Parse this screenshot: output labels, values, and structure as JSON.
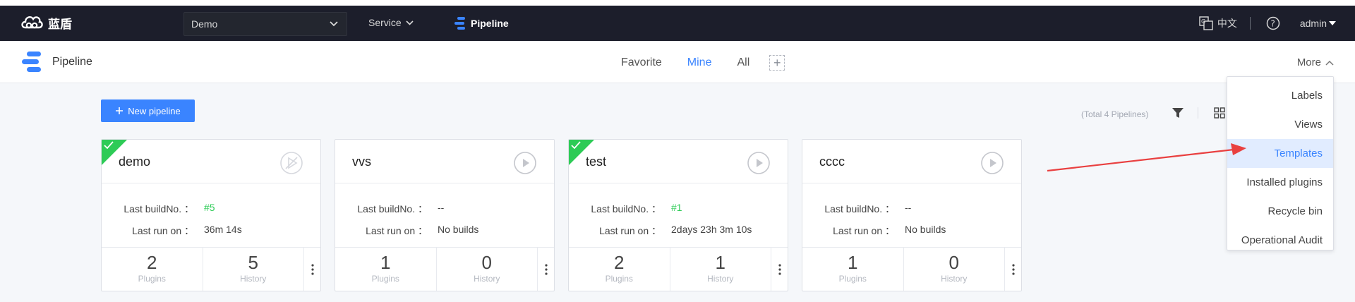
{
  "topnav": {
    "brand": "蓝盾",
    "project_select": "Demo",
    "service_label": "Service",
    "pipeline_label": "Pipeline",
    "language": "中文",
    "user": "admin"
  },
  "subheader": {
    "title": "Pipeline",
    "tabs": [
      {
        "label": "Favorite",
        "active": false
      },
      {
        "label": "Mine",
        "active": true
      },
      {
        "label": "All",
        "active": false
      }
    ],
    "more_label": "More"
  },
  "toolbar": {
    "new_pipeline": "New pipeline",
    "total": "(Total 4 Pipelines)"
  },
  "labels": {
    "last_build": "Last buildNo. ：",
    "last_run": "Last run on ：",
    "plugins": "Plugins",
    "history": "History"
  },
  "cards": [
    {
      "name": "demo",
      "success": true,
      "build_no": "#5",
      "last_run": "36m 14s",
      "plugins": "2",
      "history": "5"
    },
    {
      "name": "vvs",
      "success": false,
      "build_no": "--",
      "last_run": "No builds",
      "plugins": "1",
      "history": "0"
    },
    {
      "name": "test",
      "success": true,
      "build_no": "#1",
      "last_run": "2days 23h 3m 10s",
      "plugins": "2",
      "history": "1"
    },
    {
      "name": "cccc",
      "success": false,
      "build_no": "--",
      "last_run": "No builds",
      "plugins": "1",
      "history": "0"
    }
  ],
  "more_menu": [
    {
      "label": "Labels",
      "active": false
    },
    {
      "label": "Views",
      "active": false
    },
    {
      "label": "Templates",
      "active": true
    },
    {
      "label": "Installed plugins",
      "active": false
    },
    {
      "label": "Recycle bin",
      "active": false
    },
    {
      "label": "Operational Audit",
      "active": false
    }
  ],
  "colors": {
    "accent": "#3a84ff",
    "success": "#2dcb56",
    "nav_bg": "#1c1e2b",
    "annotation_arrow": "#e94040"
  }
}
